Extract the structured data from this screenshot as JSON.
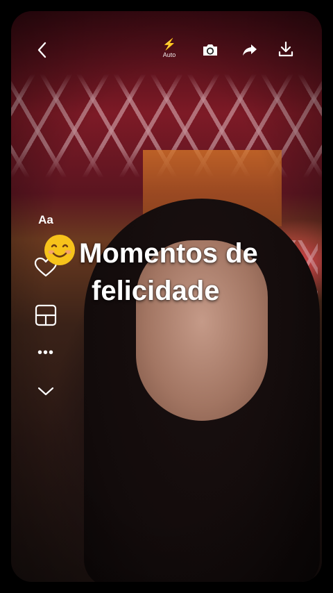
{
  "toolbar": {
    "flash_icon_glyph": "⚡",
    "flash_label": "Auto"
  },
  "side_tools": {
    "text_label": "Aa",
    "more_glyph": "•••"
  },
  "caption": {
    "line1": "Momentos de",
    "line2": "felicidade",
    "emoji": "smiling-face-icon"
  },
  "icons": [
    "back-arrow-icon",
    "flash-icon",
    "camera-flip-icon",
    "share-icon",
    "download-icon",
    "heart-icon",
    "layout-icon",
    "more-icon",
    "chevron-down-icon"
  ],
  "colors": {
    "icon": "#ffffff",
    "caption_text": "#ffffff",
    "emoji_face": "#f7c31b"
  }
}
